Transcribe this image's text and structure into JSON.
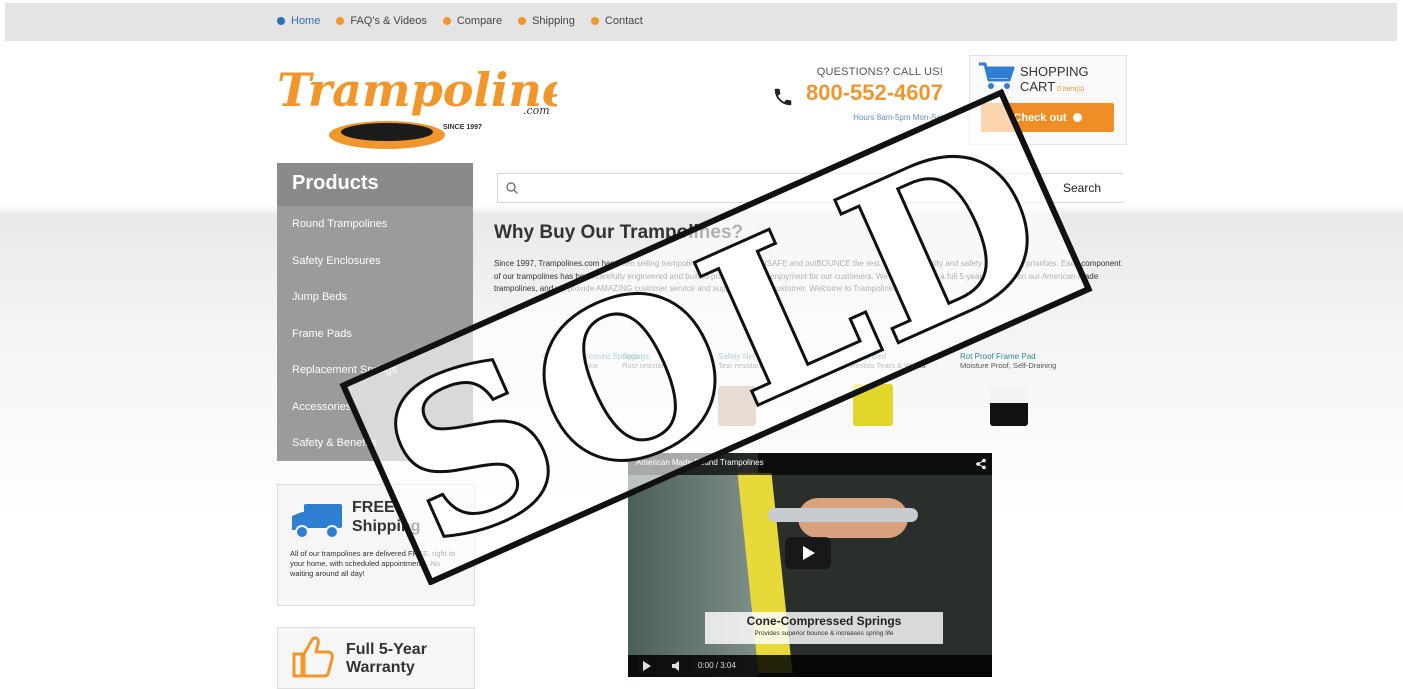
{
  "nav": {
    "items": [
      {
        "label": "Home",
        "color": "#2e6fb8"
      },
      {
        "label": "FAQ's & Videos",
        "color": "#f0962b"
      },
      {
        "label": "Compare",
        "color": "#f0962b"
      },
      {
        "label": "Shipping",
        "color": "#f0962b"
      },
      {
        "label": "Contact",
        "color": "#f0962b"
      }
    ]
  },
  "logo": {
    "text": "Trampolines",
    "suffix": ".com",
    "since": "SINCE 1997"
  },
  "contact": {
    "question": "QUESTIONS? CALL US!",
    "phone": "800-552-4607",
    "hours": "Hours 8am-5pm Mon-Sat"
  },
  "cart": {
    "title1": "SHOPPING",
    "title2": "CART",
    "count": "0 item(s)",
    "checkout": "Check out"
  },
  "sidebar": {
    "heading": "Products",
    "items": [
      {
        "label": "Round Trampolines"
      },
      {
        "label": "Safety Enclosures"
      },
      {
        "label": "Jump Beds"
      },
      {
        "label": "Frame Pads"
      },
      {
        "label": "Replacement Springs"
      },
      {
        "label": "Accessories"
      },
      {
        "label": "Safety & Benefits"
      }
    ]
  },
  "search": {
    "placeholder": "",
    "button": "Search"
  },
  "main": {
    "title": "Why Buy Our Trampolines?",
    "intro": "Since 1997, Trampolines.com has been selling trampolines that outLAST, outSAFE and outBOUNCE the rest. We make quality and safety our highest priorities. Each component of our trampolines has been carefully engineered and built to provide years of enjoyment for our customers. We back this with a full 5-year warranty on our American-made trampolines, and we provide AMAZING customer service and support to every customer. Welcome to Trampolines.com!"
  },
  "features": [
    {
      "name": "Cone-Compressed Springs",
      "sub": "Superior bounce"
    },
    {
      "name": "Springs",
      "sub": "Rust resistant"
    },
    {
      "name": "Safety Net",
      "sub": "Tear resistant"
    },
    {
      "name": "Jump Bed",
      "sub": "Resists Tears & Wears"
    },
    {
      "name": "Rot Proof Frame Pad",
      "sub": "Moisture Proof, Self-Draining"
    }
  ],
  "video": {
    "title": "American Made Round Trampolines",
    "caption": "Cone-Compressed Springs",
    "subcaption": "Provides superior bounce & increases spring life",
    "time": "0:00 / 3:04"
  },
  "shipping_card": {
    "title1": "FREE",
    "title2": "Shipping",
    "text": "All of our trampolines are delivered FREE, right to your home, with scheduled appointments. No waiting around all day!"
  },
  "warranty_card": {
    "title1": "Full 5-Year",
    "title2": "Warranty"
  },
  "stamp": {
    "text": "SOLD"
  },
  "colors": {
    "accent": "#f0962b",
    "sidebar": "#9b9b9b",
    "link": "#2f8c9a"
  }
}
